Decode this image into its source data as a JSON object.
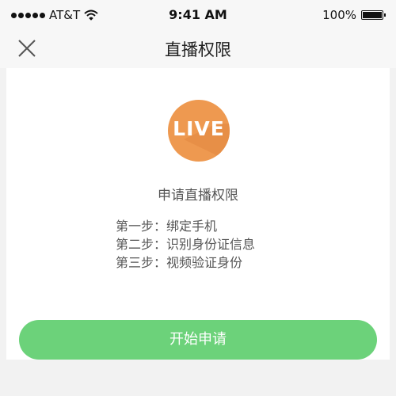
{
  "status_bar": {
    "carrier": "AT&T",
    "time": "9:41 AM",
    "battery": "100%",
    "signal_icon": "signal-dots-icon",
    "wifi_icon": "wifi-icon",
    "battery_icon": "battery-icon"
  },
  "nav": {
    "title": "直播权限",
    "close_icon": "close-icon"
  },
  "main": {
    "live_badge": "LIVE",
    "subtitle": "申请直播权限",
    "steps": [
      "第一步：绑定手机",
      "第二步：识别身份证信息",
      "第三步：视频验证身份"
    ],
    "start_button": "开始申请"
  },
  "colors": {
    "accent_green": "#6cd27a",
    "live_orange": "#ee9950"
  }
}
